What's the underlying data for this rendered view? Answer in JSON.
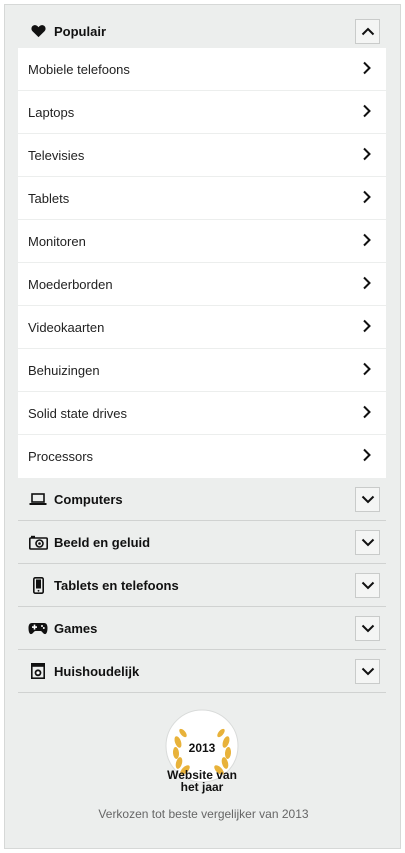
{
  "popular": {
    "title": "Populair",
    "icon": "heart-icon",
    "expanded": true,
    "items": [
      "Mobiele telefoons",
      "Laptops",
      "Televisies",
      "Tablets",
      "Monitoren",
      "Moederborden",
      "Videokaarten",
      "Behuizingen",
      "Solid state drives",
      "Processors"
    ]
  },
  "categories": [
    {
      "label": "Computers",
      "icon": "laptop-icon"
    },
    {
      "label": "Beeld en geluid",
      "icon": "camera-icon"
    },
    {
      "label": "Tablets en telefoons",
      "icon": "phone-icon"
    },
    {
      "label": "Games",
      "icon": "gamepad-icon"
    },
    {
      "label": "Huishoudelijk",
      "icon": "washing-machine-icon"
    }
  ],
  "award": {
    "year": "2013",
    "title_line1": "Website van",
    "title_line2": "het jaar",
    "caption": "Verkozen tot beste vergelijker van 2013"
  },
  "colors": {
    "panel_bg": "#eceeed",
    "laurel": "#e8b23a",
    "text": "#222222"
  }
}
